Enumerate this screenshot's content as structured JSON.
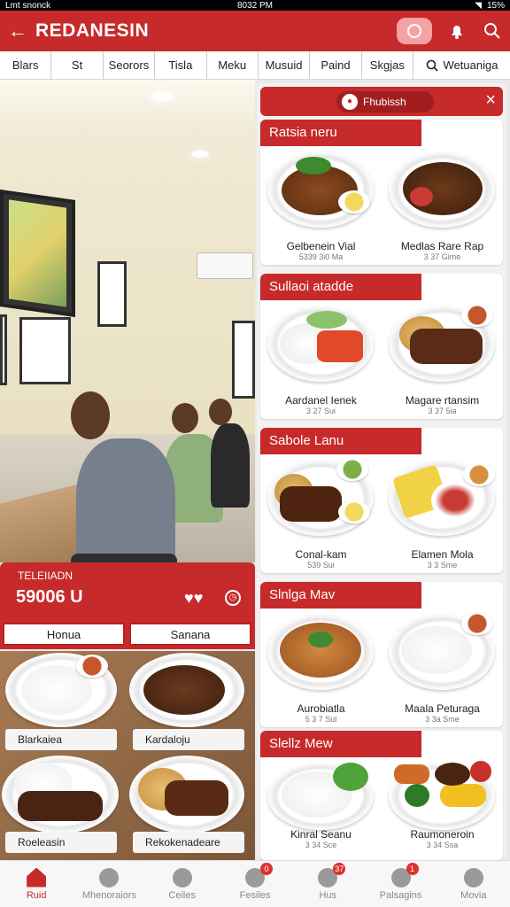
{
  "status_bar": {
    "carrier": "Lmt snonck",
    "time": "8032 PM",
    "battery": "15%"
  },
  "app_bar": {
    "title": "REDANESIN",
    "back_icon": "arrow-left-icon",
    "actions": [
      "chat-icon",
      "bell-icon",
      "search-icon"
    ]
  },
  "tabs": {
    "items": [
      "Blars",
      "St",
      "Seorors",
      "Tisla",
      "Meku",
      "Musuid",
      "Paind",
      "Skgjas"
    ],
    "search_label": "Wetuaniga"
  },
  "promo": {
    "title": "TELEIIADN",
    "price": "59006 U",
    "hearts": "♥♥",
    "buttons": [
      "Honua",
      "Sanana"
    ]
  },
  "left_dishes": [
    "Blarkaiea",
    "Kardaloju",
    "Roeleasin",
    "Rekokenadeare"
  ],
  "panel": {
    "header_pill": "Fhubissh",
    "sections": [
      {
        "title": "Ratsia neru",
        "dishes": [
          {
            "name": "Gelbenein Vial",
            "price": "5339 3i0 Ma"
          },
          {
            "name": "Medlas Rare Rap",
            "price": "3 37 Gime"
          }
        ]
      },
      {
        "title": "Sullaoi atadde",
        "dishes": [
          {
            "name": "Aardanel Ienek",
            "price": "3 27 Sui"
          },
          {
            "name": "Magare rtansim",
            "price": "3 37 5ia"
          }
        ]
      },
      {
        "title": "Sabole Lanu",
        "dishes": [
          {
            "name": "Conal-kam",
            "price": "539 Sui"
          },
          {
            "name": "Elamen Mola",
            "price": "3 3 Sme"
          }
        ]
      },
      {
        "title": "Slnlga Mav",
        "dishes": [
          {
            "name": "Aurobiatla",
            "price": "5 3 7 Sul"
          },
          {
            "name": "Maala Peturaga",
            "price": "3 3a Sme"
          }
        ]
      },
      {
        "title": "Slellz Mew",
        "dishes": [
          {
            "name": "Kinral Seanu",
            "price": "3 34 Sce"
          },
          {
            "name": "Raumoneroin",
            "price": "3 34 Ssa"
          }
        ]
      }
    ]
  },
  "bottom_nav": [
    {
      "label": "Ruid",
      "icon": "home-icon",
      "badge": ""
    },
    {
      "label": "Mhenoraiors",
      "icon": "person-icon",
      "badge": ""
    },
    {
      "label": "Ceiles",
      "icon": "circle-icon",
      "badge": ""
    },
    {
      "label": "Fesiles",
      "icon": "user-group-icon",
      "badge": "0"
    },
    {
      "label": "Hus",
      "icon": "search-person-icon",
      "badge": "37"
    },
    {
      "label": "Palsagins",
      "icon": "profile-icon",
      "badge": "1"
    },
    {
      "label": "Movia",
      "icon": "account-icon",
      "badge": ""
    }
  ],
  "colors": {
    "brand": "#c72a2a",
    "brand_dark": "#a21e1e"
  }
}
